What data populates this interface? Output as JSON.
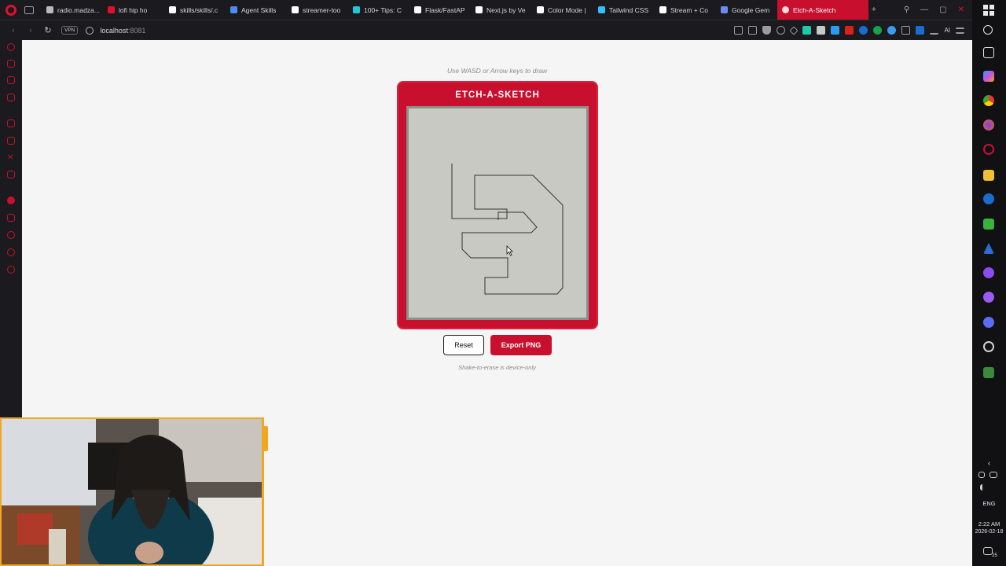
{
  "browser": {
    "tabs": [
      {
        "label": "radio.madza...",
        "color": "#bbbbbb"
      },
      {
        "label": "lofi hip ho",
        "color": "#e0102c"
      },
      {
        "label": "skills/skills/.c",
        "color": "#ffffff"
      },
      {
        "label": "Agent Skills",
        "color": "#4a8cf0"
      },
      {
        "label": "streamer-too",
        "color": "#ffffff"
      },
      {
        "label": "100+ Tips: C",
        "color": "#1ec8d8"
      },
      {
        "label": "Flask/FastAP",
        "color": "#ffffff"
      },
      {
        "label": "Next.js by Ve",
        "color": "#ffffff"
      },
      {
        "label": "Color Mode |",
        "color": "#ffffff"
      },
      {
        "label": "Tailwind CSS",
        "color": "#38bdf8"
      },
      {
        "label": "Stream + Co",
        "color": "#ffffff"
      },
      {
        "label": "Google Gem",
        "color": "#6a8cf0"
      }
    ],
    "active_tab": "Etch-A-Sketch",
    "vpn_label": "VPN",
    "url_host": "localhost",
    "url_port": ":8081",
    "ai_label": "AI"
  },
  "page": {
    "hint": "Use WASD or Arrow keys to draw",
    "title": "ETCH-A-SKETCH",
    "reset_label": "Reset",
    "export_label": "Export PNG",
    "shake_note": "Shake-to-erase is device-only"
  },
  "taskbar": {
    "language": "ENG",
    "time": "2:22 AM",
    "date": "2026-02-18",
    "notification_count": "25"
  },
  "colors": {
    "accent": "#c8102e",
    "screen": "#c9c9c4",
    "frame_border": "#8e8e8a"
  },
  "icons": {
    "back": "arrow-left-icon",
    "forward": "arrow-right-icon",
    "reload": "reload-icon",
    "globe": "globe-icon",
    "cursor": "mouse-pointer-icon"
  }
}
